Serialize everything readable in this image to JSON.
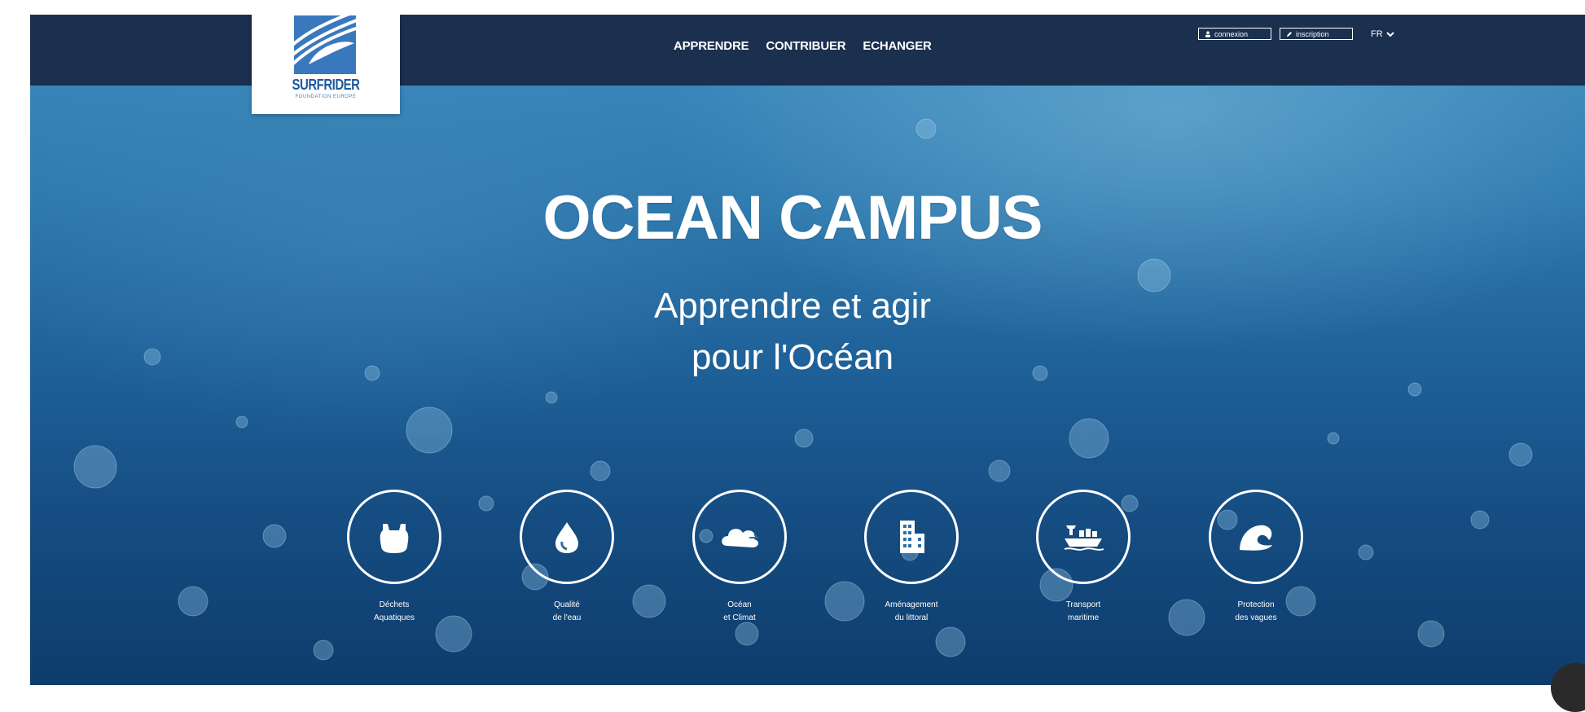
{
  "brand": {
    "name": "SURFRIDER",
    "tagline": "FOUNDATION EUROPE",
    "color": "#1f5a9c"
  },
  "nav": {
    "links": [
      "APPRENDRE",
      "CONTRIBUER",
      "ECHANGER"
    ],
    "login_label": "connexion",
    "signup_label": "inscription",
    "language": "FR",
    "background": "#1b2f4e"
  },
  "hero": {
    "title": "OCEAN CAMPUS",
    "subtitle_line1": "Apprendre et agir",
    "subtitle_line2": "pour l'Océan"
  },
  "themes": [
    {
      "label": "Déchets\nAquatiques",
      "icon": "plastic-bag-icon"
    },
    {
      "label": "Qualité\nde l'eau",
      "icon": "water-drop-icon"
    },
    {
      "label": "Océan\net Climat",
      "icon": "cloud-icon"
    },
    {
      "label": "Aménagement\ndu littoral",
      "icon": "building-icon"
    },
    {
      "label": "Transport\nmaritime",
      "icon": "cargo-ship-icon"
    },
    {
      "label": "Protection\ndes vagues",
      "icon": "wave-icon"
    }
  ]
}
